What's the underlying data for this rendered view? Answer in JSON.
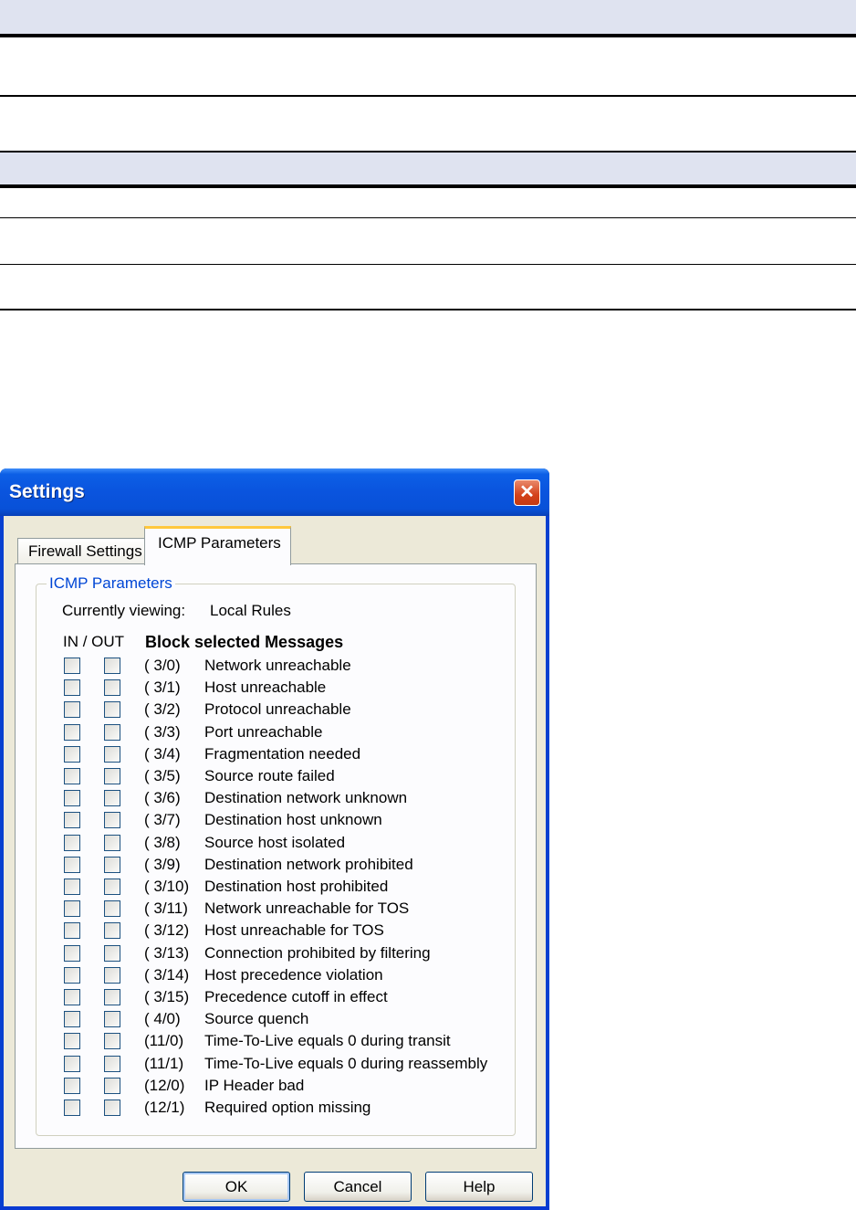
{
  "dialog": {
    "title": "Settings",
    "close_symbol": "✕",
    "tabs": [
      {
        "label": "Firewall Settings",
        "selected": false
      },
      {
        "label": "ICMP Parameters",
        "selected": true
      }
    ],
    "group_title": "ICMP Parameters",
    "viewing_label": "Currently viewing:",
    "viewing_value": "Local Rules",
    "col_in_out": "IN / OUT",
    "col_block": "Block selected Messages",
    "messages": [
      {
        "code": "( 3/0)",
        "text": "Network unreachable"
      },
      {
        "code": "( 3/1)",
        "text": "Host unreachable"
      },
      {
        "code": "( 3/2)",
        "text": "Protocol unreachable"
      },
      {
        "code": "( 3/3)",
        "text": "Port unreachable"
      },
      {
        "code": "( 3/4)",
        "text": "Fragmentation needed"
      },
      {
        "code": "( 3/5)",
        "text": "Source route failed"
      },
      {
        "code": "( 3/6)",
        "text": "Destination network unknown"
      },
      {
        "code": "( 3/7)",
        "text": "Destination host unknown"
      },
      {
        "code": "( 3/8)",
        "text": "Source host isolated"
      },
      {
        "code": "( 3/9)",
        "text": "Destination network prohibited"
      },
      {
        "code": "( 3/10)",
        "text": "Destination host prohibited"
      },
      {
        "code": "( 3/11)",
        "text": "Network unreachable for TOS"
      },
      {
        "code": "( 3/12)",
        "text": "Host unreachable for TOS"
      },
      {
        "code": "( 3/13)",
        "text": "Connection prohibited by filtering"
      },
      {
        "code": "( 3/14)",
        "text": "Host precedence violation"
      },
      {
        "code": "( 3/15)",
        "text": "Precedence cutoff in effect"
      },
      {
        "code": "( 4/0)",
        "text": "Source quench"
      },
      {
        "code": "(11/0)",
        "text": "Time-To-Live equals 0 during transit"
      },
      {
        "code": "(11/1)",
        "text": "Time-To-Live equals 0 during reassembly"
      },
      {
        "code": "(12/0)",
        "text": "IP Header bad"
      },
      {
        "code": "(12/1)",
        "text": "Required option missing"
      }
    ],
    "buttons": {
      "ok": "OK",
      "cancel": "Cancel",
      "help": "Help"
    }
  }
}
